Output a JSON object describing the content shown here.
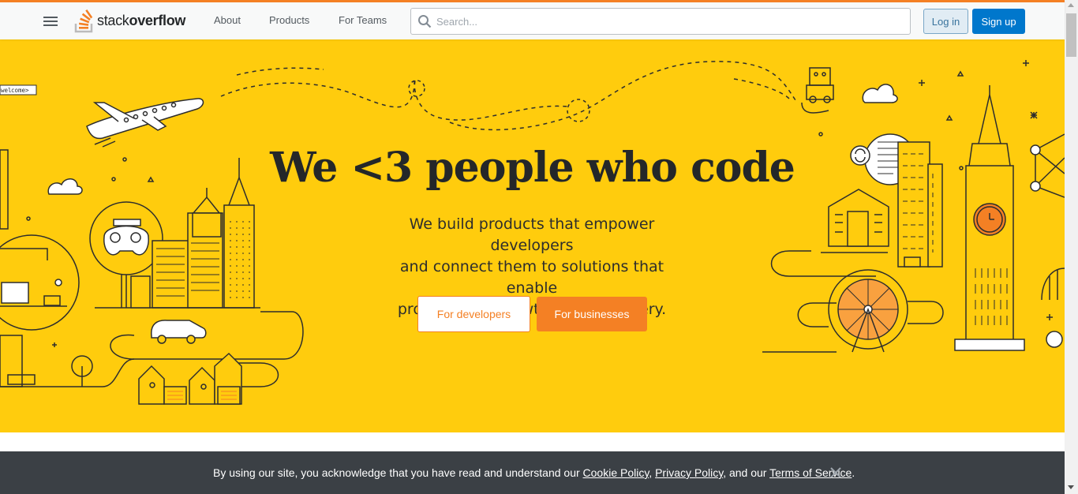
{
  "header": {
    "logo_light": "stack",
    "logo_bold": "overflow",
    "nav": [
      "About",
      "Products",
      "For Teams"
    ],
    "search_placeholder": "Search...",
    "login_label": "Log in",
    "signup_label": "Sign up"
  },
  "hero": {
    "headline": "We <3 people who code",
    "subtitle_lines": [
      "We build products that empower developers",
      "and connect them to solutions that enable",
      "productivity, growth, and discovery."
    ],
    "developers_button": "For developers",
    "businesses_button": "For businesses",
    "sign_text": "welcome"
  },
  "cookie_banner": {
    "prefix": "By using our site, you acknowledge that you have read and understand our ",
    "cookie_policy": "Cookie Policy",
    "sep1": ", ",
    "privacy_policy": "Privacy Policy",
    "sep2": ", and our ",
    "terms": "Terms of Service",
    "suffix": "."
  },
  "colors": {
    "accent": "#f48024",
    "hero_bg": "#ffcc0d",
    "primary_blue": "#0077cc",
    "banner_bg": "#3b4045"
  },
  "icons": [
    "menu-icon",
    "stack-overflow-logo-icon",
    "search-icon",
    "close-icon"
  ]
}
